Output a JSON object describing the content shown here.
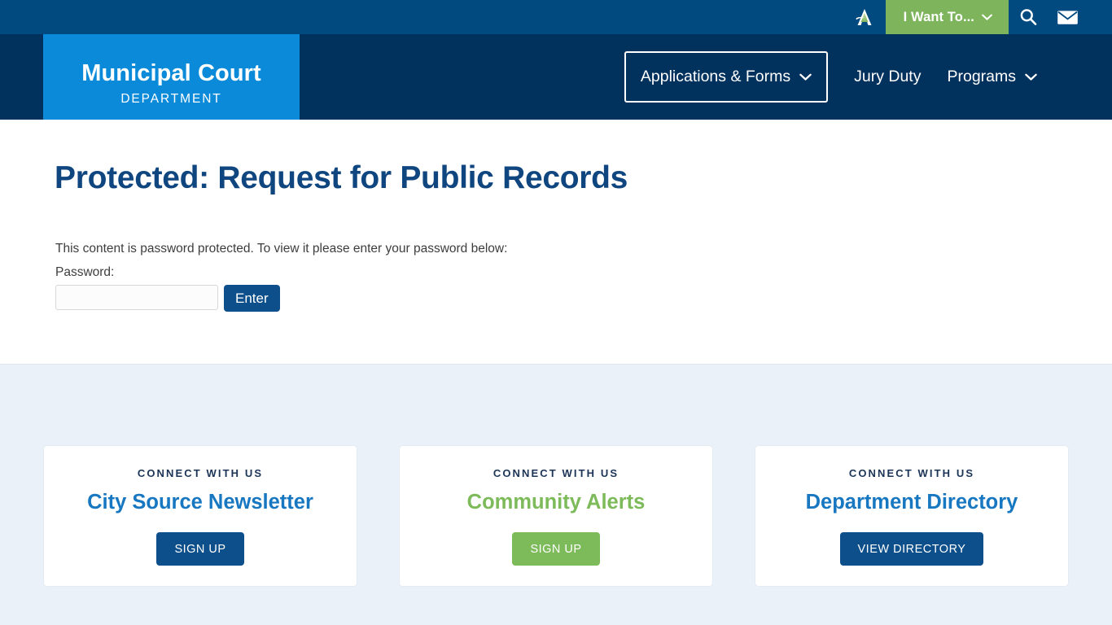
{
  "topbar": {
    "accessibility_icon": "accessibility-a-logo-icon",
    "i_want_to_label": "I Want To...",
    "i_want_to_caret": "chevron-down-icon",
    "search_icon": "search-icon",
    "mail_icon": "envelope-icon",
    "bg_color": "#014a80",
    "green_color": "#7db45c"
  },
  "nav": {
    "logo": {
      "title": "Municipal Court",
      "subtitle": "DEPARTMENT",
      "bg_color": "#0a8ad8"
    },
    "bg_color": "#01315d",
    "items": [
      {
        "label": "Applications & Forms",
        "has_caret": true,
        "focused": true
      },
      {
        "label": "Jury Duty",
        "has_caret": false,
        "focused": false
      },
      {
        "label": "Programs",
        "has_caret": true,
        "focused": false
      }
    ]
  },
  "main": {
    "page_title": "Protected: Request for Public Records",
    "title_color": "#10467f",
    "protected_message": "This content is password protected. To view it please enter your password below:",
    "password_label": "Password:",
    "password_value": "",
    "password_placeholder": "",
    "enter_label": "Enter",
    "enter_color": "#0d4f8b"
  },
  "connect": {
    "section_bg": "#eaf1f9",
    "cards": [
      {
        "eyebrow": "CONNECT WITH US",
        "title": "City Source Newsletter",
        "title_color": "#1877c1",
        "button_label": "SIGN UP",
        "button_color": "#0d4f8b"
      },
      {
        "eyebrow": "CONNECT WITH US",
        "title": "Community Alerts",
        "title_color": "#7dbb5a",
        "button_label": "SIGN UP",
        "button_color": "#7dbb5a"
      },
      {
        "eyebrow": "CONNECT WITH US",
        "title": "Department Directory",
        "title_color": "#1877c1",
        "button_label": "VIEW DIRECTORY",
        "button_color": "#0d4f8b"
      }
    ]
  }
}
